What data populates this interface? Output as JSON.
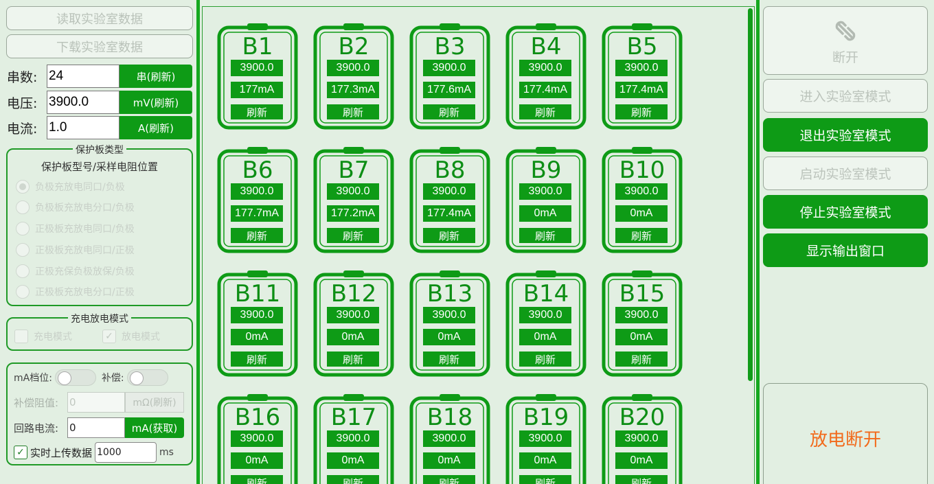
{
  "left": {
    "read_btn": "读取实验室数据",
    "download_btn": "下载实验室数据",
    "params": [
      {
        "label": "串数:",
        "value": "24",
        "btn": "串(刷新)"
      },
      {
        "label": "电压:",
        "value": "3900.0",
        "btn": "mV(刷新)"
      },
      {
        "label": "电流:",
        "value": "1.0",
        "btn": "A(刷新)"
      }
    ],
    "board_group": {
      "title": "保护板类型",
      "subtitle": "保护板型号/采样电阻位置",
      "options": [
        "负极充放电同口/负极",
        "负极板充放电分口/负极",
        "正极板充放电同口/负极",
        "正极板充放电同口/正极",
        "正极充保负极放保/负极",
        "正极板充放电分口/正极"
      ]
    },
    "mode_group": {
      "title": "充电放电模式",
      "charge": "充电模式",
      "discharge": "放电模式"
    },
    "settings": {
      "ma_label": "mA档位:",
      "comp_label": "补偿:",
      "comp_res_label": "补偿阻值:",
      "comp_res_value": "0",
      "comp_res_btn": "mΩ(刷新)",
      "loop_label": "回路电流:",
      "loop_value": "0",
      "loop_btn": "mA(获取)",
      "upload_label": "实时上传数据",
      "upload_value": "1000",
      "upload_unit": "ms"
    }
  },
  "cells": [
    {
      "name": "B1",
      "voltage": "3900.0",
      "current": "177mA",
      "refresh": "刷新"
    },
    {
      "name": "B2",
      "voltage": "3900.0",
      "current": "177.3mA",
      "refresh": "刷新"
    },
    {
      "name": "B3",
      "voltage": "3900.0",
      "current": "177.6mA",
      "refresh": "刷新"
    },
    {
      "name": "B4",
      "voltage": "3900.0",
      "current": "177.4mA",
      "refresh": "刷新"
    },
    {
      "name": "B5",
      "voltage": "3900.0",
      "current": "177.4mA",
      "refresh": "刷新"
    },
    {
      "name": "B6",
      "voltage": "3900.0",
      "current": "177.7mA",
      "refresh": "刷新"
    },
    {
      "name": "B7",
      "voltage": "3900.0",
      "current": "177.2mA",
      "refresh": "刷新"
    },
    {
      "name": "B8",
      "voltage": "3900.0",
      "current": "177.4mA",
      "refresh": "刷新"
    },
    {
      "name": "B9",
      "voltage": "3900.0",
      "current": "0mA",
      "refresh": "刷新"
    },
    {
      "name": "B10",
      "voltage": "3900.0",
      "current": "0mA",
      "refresh": "刷新"
    },
    {
      "name": "B11",
      "voltage": "3900.0",
      "current": "0mA",
      "refresh": "刷新"
    },
    {
      "name": "B12",
      "voltage": "3900.0",
      "current": "0mA",
      "refresh": "刷新"
    },
    {
      "name": "B13",
      "voltage": "3900.0",
      "current": "0mA",
      "refresh": "刷新"
    },
    {
      "name": "B14",
      "voltage": "3900.0",
      "current": "0mA",
      "refresh": "刷新"
    },
    {
      "name": "B15",
      "voltage": "3900.0",
      "current": "0mA",
      "refresh": "刷新"
    },
    {
      "name": "B16",
      "voltage": "3900.0",
      "current": "0mA",
      "refresh": "刷新"
    },
    {
      "name": "B17",
      "voltage": "3900.0",
      "current": "0mA",
      "refresh": "刷新"
    },
    {
      "name": "B18",
      "voltage": "3900.0",
      "current": "0mA",
      "refresh": "刷新"
    },
    {
      "name": "B19",
      "voltage": "3900.0",
      "current": "0mA",
      "refresh": "刷新"
    },
    {
      "name": "B20",
      "voltage": "3900.0",
      "current": "0mA",
      "refresh": "刷新"
    }
  ],
  "right": {
    "disconnect_icon": "unlink-icon",
    "disconnect_label": "断开",
    "enter_lab": "进入实验室模式",
    "exit_lab": "退出实验室模式",
    "start_lab": "启动实验室模式",
    "stop_lab": "停止实验室模式",
    "show_output": "显示输出窗口",
    "status": "放电断开"
  },
  "colors": {
    "accent": "#0e9b16",
    "status": "#f26a1b",
    "background": "#e2efe2"
  }
}
